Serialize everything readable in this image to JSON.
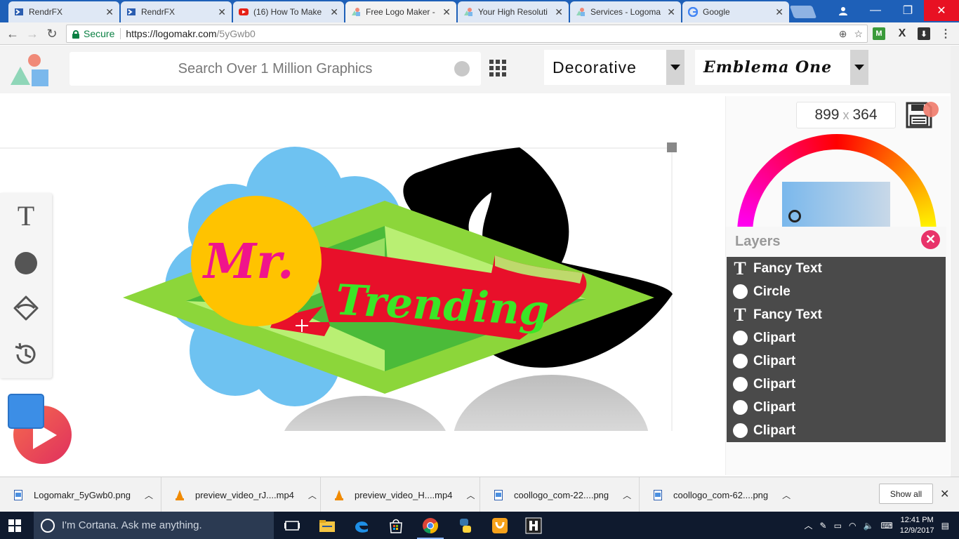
{
  "browser": {
    "tabs": [
      {
        "label": "RendrFX",
        "icon": "rendrfx-icon",
        "active": false
      },
      {
        "label": "RendrFX",
        "icon": "rendrfx-icon",
        "active": false
      },
      {
        "label": "(16) How To Make",
        "icon": "youtube-icon",
        "active": false
      },
      {
        "label": "Free Logo Maker -",
        "icon": "logomakr-icon",
        "active": true
      },
      {
        "label": "Your High Resoluti",
        "icon": "logomakr-icon",
        "active": false
      },
      {
        "label": "Services - Logoma",
        "icon": "logomakr-icon",
        "active": false
      },
      {
        "label": "Google",
        "icon": "google-icon",
        "active": false
      }
    ],
    "secure_label": "Secure",
    "url_host": "https://logomakr.com",
    "url_path": "/5yGwb0"
  },
  "app": {
    "search_placeholder": "Search Over 1 Million Graphics",
    "font_category": "Decorative",
    "font_name": "Emblema One",
    "canvas_width": "899",
    "canvas_height": "364",
    "dims_separator": "x"
  },
  "logo_artwork": {
    "title_word": "Mr.",
    "subtitle_word": "Trending"
  },
  "layers": {
    "title": "Layers",
    "items": [
      {
        "label": "Fancy Text",
        "icon": "text-icon"
      },
      {
        "label": "Circle",
        "icon": "circle-icon"
      },
      {
        "label": "Fancy Text",
        "icon": "text-icon"
      },
      {
        "label": "Clipart",
        "icon": "circle-icon"
      },
      {
        "label": "Clipart",
        "icon": "circle-icon"
      },
      {
        "label": "Clipart",
        "icon": "circle-icon"
      },
      {
        "label": "Clipart",
        "icon": "circle-icon"
      },
      {
        "label": "Clipart",
        "icon": "circle-icon"
      }
    ]
  },
  "tools": {
    "text_tool_glyph": "T"
  },
  "downloads": {
    "items": [
      {
        "label": "Logomakr_5yGwb0.png",
        "type": "png"
      },
      {
        "label": "preview_video_rJ....mp4",
        "type": "vlc"
      },
      {
        "label": "preview_video_H....mp4",
        "type": "vlc"
      },
      {
        "label": "coollogo_com-22....png",
        "type": "png"
      },
      {
        "label": "coollogo_com-62....png",
        "type": "png"
      }
    ],
    "show_all_label": "Show all"
  },
  "taskbar": {
    "cortana_placeholder": "I'm Cortana. Ask me anything.",
    "time": "12:41 PM",
    "date": "12/9/2017"
  },
  "colors": {
    "accent_blue": "#1e60b8",
    "close_pink": "#e8336a",
    "banner_red": "#e8102a",
    "text_green": "#3be626",
    "diamond_green": "#8cd63a",
    "sun_yellow": "#ffc300",
    "mr_pink": "#f0148c",
    "flower_blue": "#62bdf0"
  }
}
